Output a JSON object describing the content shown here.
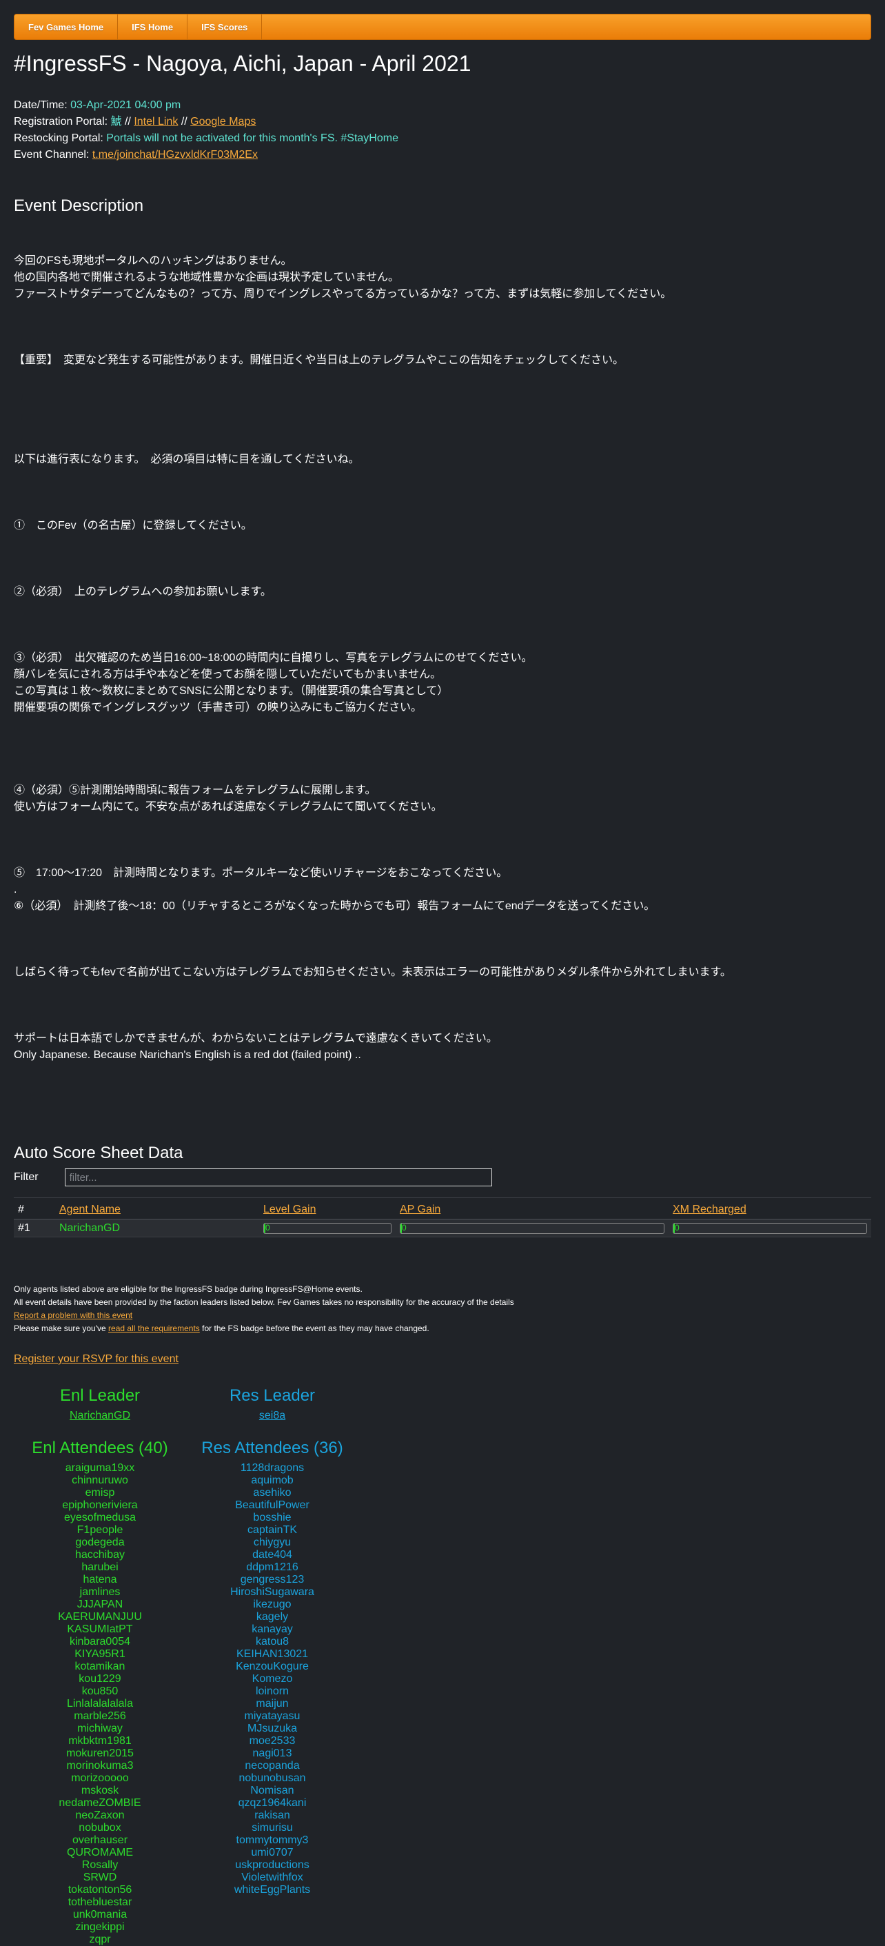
{
  "nav": [
    "Fev Games Home",
    "IFS Home",
    "IFS Scores"
  ],
  "page_title": "#IngressFS - Nagoya, Aichi, Japan - April 2021",
  "info": {
    "datetime_label": "Date/Time:",
    "datetime_value": "03-Apr-2021 04:00 pm",
    "reg_label": "Registration Portal:",
    "reg_portal": "鯱",
    "sep": "//",
    "intel_link": "Intel Link",
    "maps_link": "Google Maps",
    "restock_label": "Restocking Portal:",
    "restock_value": "Portals will not be activated for this month's FS. #StayHome",
    "channel_label": "Event Channel:",
    "channel_link": "t.me/joinchat/HGzvxldKrF03M2Ex"
  },
  "description": {
    "heading": "Event Description",
    "p1": "今回のFSも現地ポータルへのハッキングはありません。\n他の国内各地で開催されるような地域性豊かな企画は現状予定していません。\nファーストサタデーってどんなもの？って方、周りでイングレスやってる方っているかな？って方、まずは気軽に参加してください。",
    "p2": "【重要】　変更など発生する可能性があります。開催日近くや当日は上のテレグラムやここの告知をチェックしてください。",
    "p3": "以下は進行表になります。　必須の項目は特に目を通してくださいね。",
    "p4": "①　このFev（の名古屋）に登録してください。",
    "p5": "②（必須）　上のテレグラムへの参加お願いします。",
    "p6": "③（必須）　出欠確認のため当日16:00~18:00の時間内に自撮りし、写真をテレグラムにのせてください。\n顔バレを気にされる方は手や本などを使ってお顔を隠していただいてもかまいません。\nこの写真は１枚～数枚にまとめてSNSに公開となります。（開催要項の集合写真として）\n開催要項の関係でイングレスグッツ（手書き可）の映り込みにもご協力ください。",
    "p7": "④（必須）⑤計測開始時間頃に報告フォームをテレグラムに展開します。\n使い方はフォーム内にて。不安な点があれば遠慮なくテレグラムにて聞いてください。",
    "p8": "⑤　17:00～17:20　計測時間となります。ポータルキーなど使いリチャージをおこなってください。\n.\n⑥（必須）　計測終了後～18：00（リチャするところがなくなった時からでも可）報告フォームにてendデータを送ってください。",
    "p9": "しばらく待ってもfevで名前が出てこない方はテレグラムでお知らせください。未表示はエラーの可能性がありメダル条件から外れてしまいます。",
    "p10": "サポートは日本語でしかできませんが、わからないことはテレグラムで遠慮なくきいてください。\nOnly Japanese. Because Narichan's English is a red dot (failed point) .."
  },
  "score": {
    "heading": "Auto Score Sheet Data",
    "filter_label": "Filter",
    "filter_placeholder": "filter...",
    "columns": [
      "#",
      "Agent Name",
      "Level Gain",
      "AP Gain",
      "XM Recharged"
    ],
    "rows": [
      {
        "rank": "#1",
        "agent": "NarichanGD",
        "level": "0",
        "ap": "0",
        "xm": "0"
      }
    ]
  },
  "notes": {
    "line1": "Only agents listed above are eligible for the IngressFS badge during IngressFS@Home events.",
    "line2": "All event details have been provided by the faction leaders listed below. Fev Games takes no responsibility for the accuracy of the details",
    "report_link": "Report a problem with this event",
    "line4_pre": "Please make sure you've",
    "line4_link": "read all the requirements",
    "line4_post": "for the FS badge before the event as they may have changed."
  },
  "rsvp_link": "Register your RSVP for this event",
  "teams": {
    "enl": {
      "leader_heading": "Enl Leader",
      "leader": "NarichanGD",
      "attendees_heading": "Enl Attendees (40)",
      "attendees": [
        "araiguma19xx",
        "chinnuruwo",
        "emisp",
        "epiphoneriviera",
        "eyesofmedusa",
        "F1people",
        "godegeda",
        "hacchibay",
        "harubei",
        "hatena",
        "jamlines",
        "JJJAPAN",
        "KAERUMANJUU",
        "KASUMIatPT",
        "kinbara0054",
        "KIYA95R1",
        "kotamikan",
        "kou1229",
        "kou850",
        "Linlalalalalala",
        "marble256",
        "michiway",
        "mkbktm1981",
        "mokuren2015",
        "morinokuma3",
        "morizooooo",
        "mskosk",
        "nedameZOMBIE",
        "neoZaxon",
        "nobubox",
        "overhauser",
        "QUROMAME",
        "Rosally",
        "SRWD",
        "tokatonton56",
        "tothebluestar",
        "unk0mania",
        "zingekippi",
        "zqpr"
      ]
    },
    "res": {
      "leader_heading": "Res Leader",
      "leader": "sei8a",
      "attendees_heading": "Res Attendees (36)",
      "attendees": [
        "1128dragons",
        "aquimob",
        "asehiko",
        "BeautifulPower",
        "bosshie",
        "captainTK",
        "chiygyu",
        "date404",
        "ddpm1216",
        "gengress123",
        "HiroshiSugawara",
        "ikezugo",
        "kagely",
        "kanayay",
        "katou8",
        "KEIHAN13021",
        "KenzouKogure",
        "Komezo",
        "loinorn",
        "maijun",
        "miyatayasu",
        "MJsuzuka",
        "moe2533",
        "nagi013",
        "necopanda",
        "nobunobusan",
        "Nomisan",
        "qzqz1964kani",
        "rakisan",
        "simurisu",
        "tommytommy3",
        "umi0707",
        "uskproductions",
        "Violetwithfox",
        "whiteEggPlants"
      ]
    }
  },
  "colors": {
    "accent": "#f7a93b",
    "enl": "#2ddc2d",
    "res": "#1ba3dc",
    "teal": "#5ee3d1",
    "bg": "#202328"
  }
}
